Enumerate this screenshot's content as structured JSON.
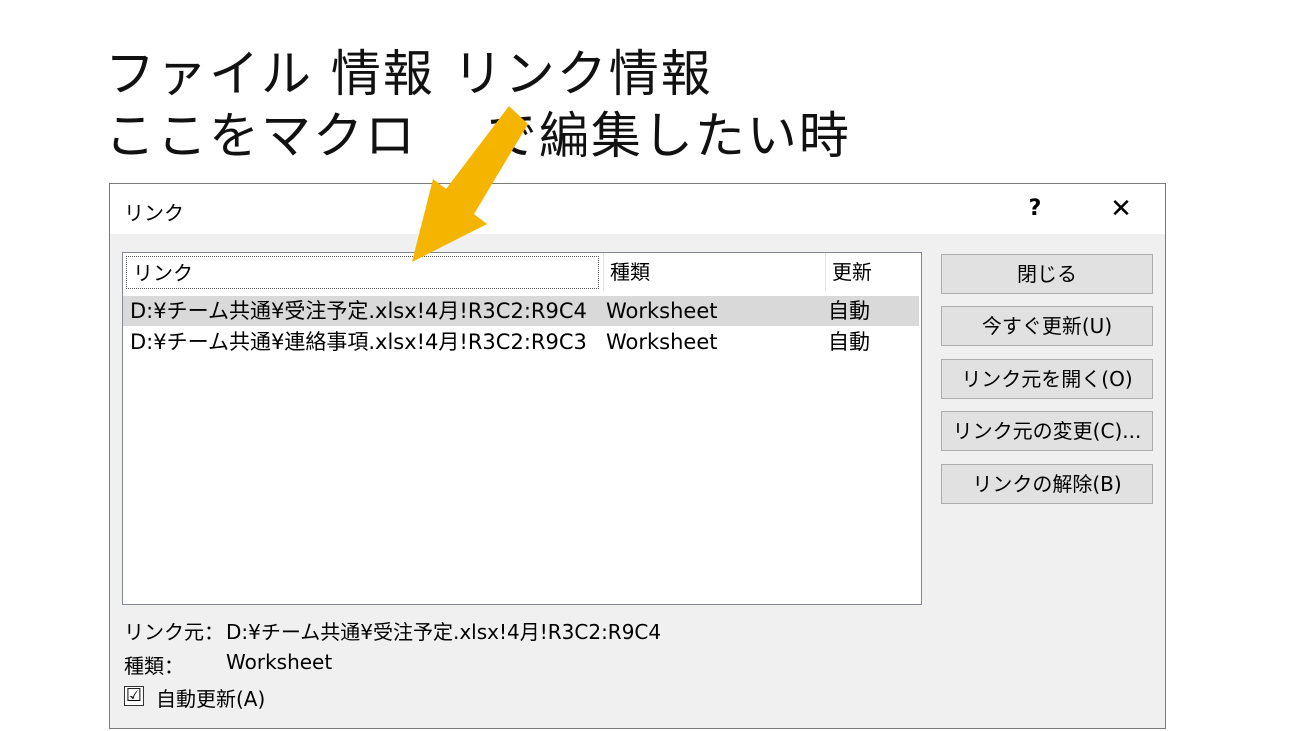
{
  "caption": {
    "line1": "ファイル 情報 リンク情報",
    "line2": "ここをマクロ　 で編集したい時"
  },
  "dialog": {
    "title": "リンク",
    "help": "?",
    "close": "✕",
    "columns": {
      "link": "リンク",
      "type": "種類",
      "update": "更新"
    },
    "rows": [
      {
        "link": "D:¥チーム共通¥受注予定.xlsx!4月!R3C2:R9C4",
        "type": "Worksheet",
        "update": "自動",
        "selected": true
      },
      {
        "link": "D:¥チーム共通¥連絡事項.xlsx!4月!R3C2:R9C3",
        "type": "Worksheet",
        "update": "自動",
        "selected": false
      }
    ],
    "buttons": {
      "close": "閉じる",
      "update_now": "今すぐ更新(U)",
      "open_source": "リンク元を開く(O)",
      "change_source": "リンク元の変更(C)...",
      "break_link": "リンクの解除(B)"
    },
    "info": {
      "source_label": "リンク元：",
      "source_value": "D:¥チーム共通¥受注予定.xlsx!4月!R3C2:R9C4",
      "type_label": "種類：",
      "type_value": "Worksheet"
    },
    "auto_update": {
      "label": "自動更新(A)",
      "checked": true,
      "mark": "☑"
    }
  },
  "colors": {
    "arrow": "#f5b400",
    "selected_row": "#d9d9d9",
    "dialog_bg": "#f0f0f0"
  }
}
